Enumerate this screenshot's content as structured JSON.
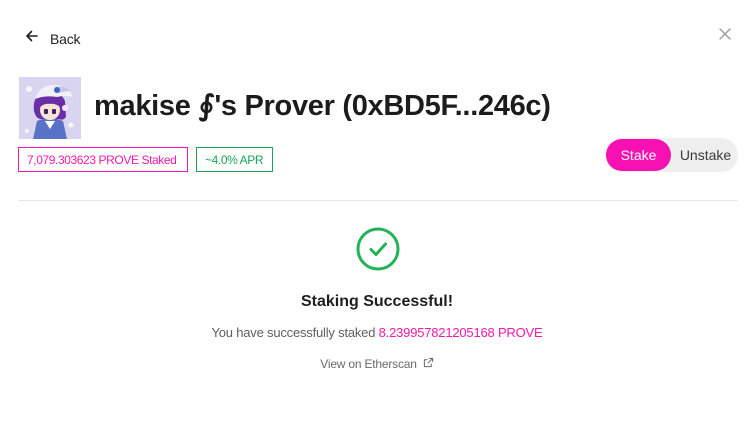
{
  "nav": {
    "back_label": "Back",
    "back_icon": "arrow-left-icon",
    "close_icon": "close-icon"
  },
  "prover": {
    "title": "makise ∮'s Prover (0xBD5F...246c)",
    "avatar_icon": "anime-avatar"
  },
  "badges": {
    "staked": "7,079.303623 PROVE Staked",
    "apr": "~4.0% APR"
  },
  "toggle": {
    "stake_label": "Stake",
    "unstake_label": "Unstake",
    "selected": "Stake"
  },
  "result": {
    "icon": "check-circle-icon",
    "title": "Staking Successful!",
    "message_prefix": "You have successfully staked ",
    "amount": "8.239957821205168 PROVE",
    "link_label": "View on Etherscan",
    "link_icon": "external-link-icon"
  },
  "colors": {
    "accent": "#f711b3",
    "accent_text": "#f21aa8",
    "success": "#1aa35a",
    "success_icon": "#22b357"
  }
}
